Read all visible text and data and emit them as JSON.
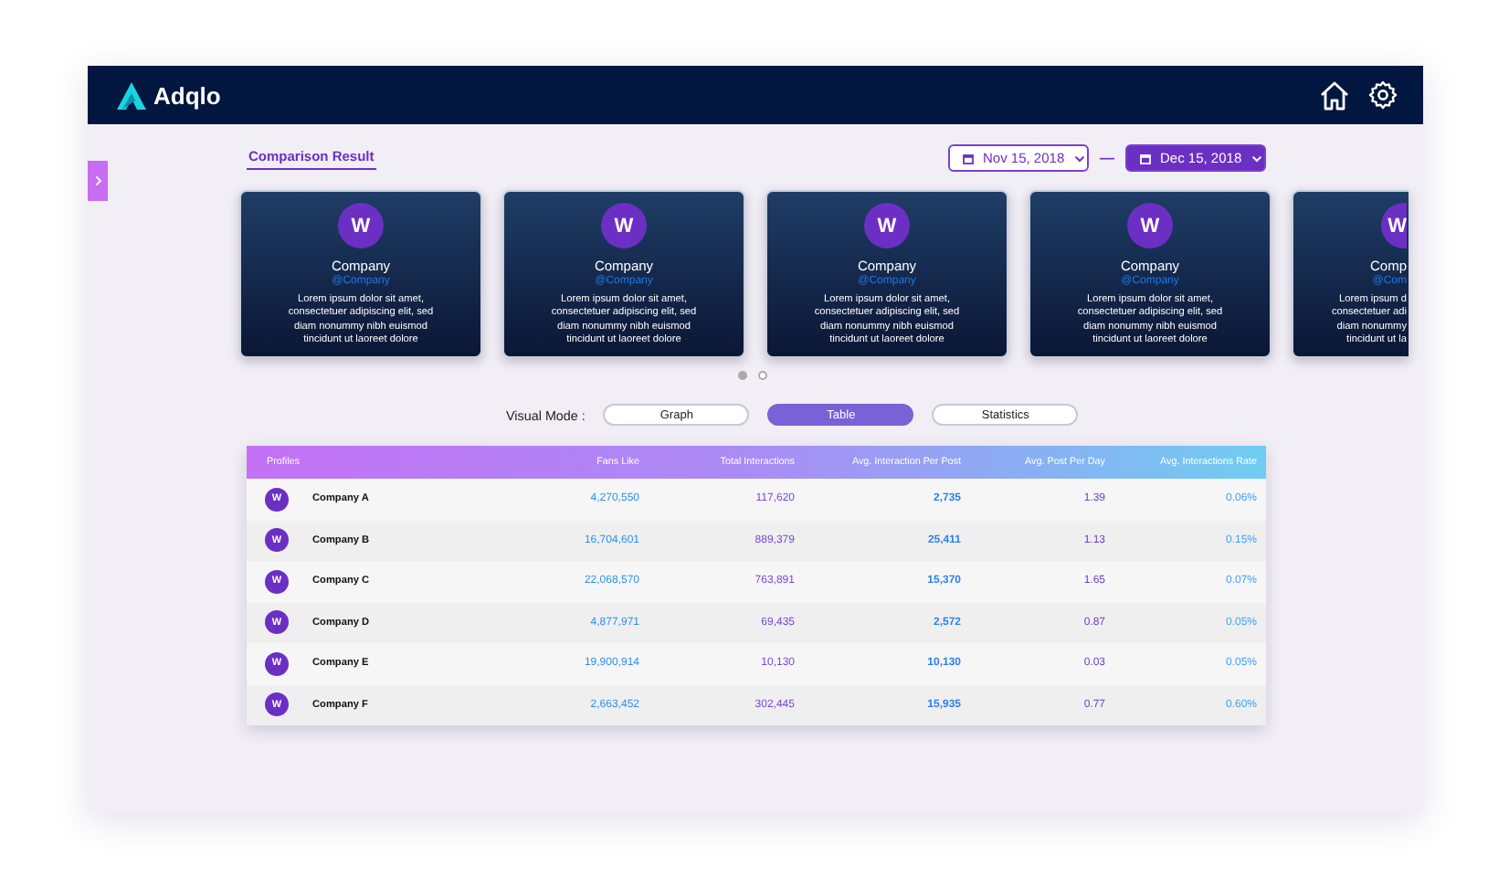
{
  "app": {
    "logo_text": "Adqlo"
  },
  "section_tab": "Comparison Result",
  "date_range": {
    "start": "Nov 15, 2018",
    "separator": "—",
    "end": "Dec 15, 2018"
  },
  "cards": [
    {
      "kind": "full",
      "avatar": "W",
      "name": "Company",
      "handle": "@Company",
      "description_lines": [
        "Lorem ipsum dolor sit amet,",
        "consectetuer adipiscing elit, sed",
        "diam nonummy nibh euismod",
        "tincidunt ut laoreet dolore"
      ]
    },
    {
      "kind": "full",
      "avatar": "W",
      "name": "Company",
      "handle": "@Company",
      "description_lines": [
        "Lorem ipsum dolor sit amet,",
        "consectetuer adipiscing elit, sed",
        "diam nonummy nibh euismod",
        "tincidunt ut laoreet dolore"
      ]
    },
    {
      "kind": "full",
      "avatar": "W",
      "name": "Company",
      "handle": "@Company",
      "description_lines": [
        "Lorem ipsum dolor sit amet,",
        "consectetuer adipiscing elit, sed",
        "diam nonummy nibh euismod",
        "tincidunt ut laoreet dolore"
      ]
    },
    {
      "kind": "full",
      "avatar": "W",
      "name": "Company",
      "handle": "@Company",
      "description_lines": [
        "Lorem ipsum dolor sit amet,",
        "consectetuer adipiscing elit, sed",
        "diam nonummy nibh euismod",
        "tincidunt ut laoreet dolore"
      ]
    },
    {
      "kind": "partial",
      "avatar": "W",
      "name": "Comp",
      "handle": "@Com",
      "description_lines": [
        "Lorem ipsum d",
        "consectetuer adi",
        "diam nonummy",
        "tincidunt ut la"
      ]
    }
  ],
  "pager": [
    {
      "selected": true
    },
    {
      "selected": false
    }
  ],
  "visual_mode": {
    "label": "Visual Mode :",
    "options": [
      {
        "label": "Graph",
        "selected": false
      },
      {
        "label": "Table",
        "selected": true
      },
      {
        "label": "Statistics",
        "selected": false
      }
    ]
  },
  "table": {
    "columns": [
      "Profiles",
      "Fans Like",
      "Total Interactions",
      "Avg. Interaction Per Post",
      "Avg. Post Per Day",
      "Avg. Interactions Rate"
    ],
    "rows": [
      {
        "avatar": "W",
        "profile": "Company A",
        "values": [
          "4,270,550",
          "117,620",
          "2,735",
          "1.39",
          "0.06%"
        ]
      },
      {
        "avatar": "W",
        "profile": "Company B",
        "values": [
          "16,704,601",
          "889,379",
          "25,411",
          "1.13",
          "0.15%"
        ]
      },
      {
        "avatar": "W",
        "profile": "Company C",
        "values": [
          "22,068,570",
          "763,891",
          "15,370",
          "1.65",
          "0.07%"
        ]
      },
      {
        "avatar": "W",
        "profile": "Company D",
        "values": [
          "4,877,971",
          "69,435",
          "2,572",
          "0.87",
          "0.05%"
        ]
      },
      {
        "avatar": "W",
        "profile": "Company E",
        "values": [
          "19,900,914",
          "10,130",
          "10,130",
          "0.03",
          "0.05%"
        ]
      },
      {
        "avatar": "W",
        "profile": "Company F",
        "values": [
          "2,663,452",
          "302,445",
          "15,935",
          "0.77",
          "0.60%"
        ]
      }
    ]
  }
}
